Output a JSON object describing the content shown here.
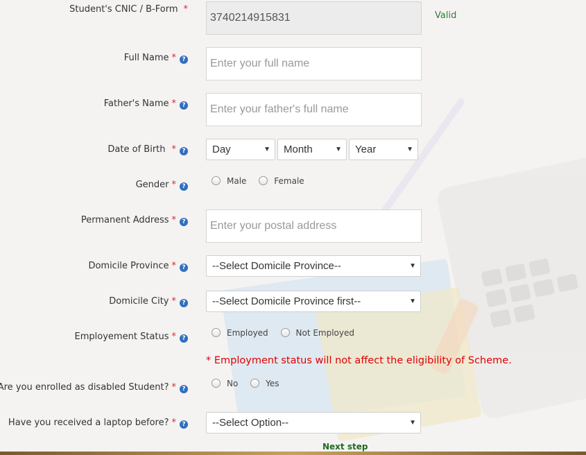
{
  "form": {
    "cnic": {
      "label": "Student's CNIC / B-Form",
      "required": "*",
      "value": "3740214915831",
      "status": "Valid"
    },
    "full_name": {
      "label": "Full Name",
      "required": "*",
      "help": "?",
      "placeholder": "Enter your full name"
    },
    "father_name": {
      "label": "Father's Name",
      "required": "*",
      "help": "?",
      "placeholder": "Enter your father's full name"
    },
    "dob": {
      "label": "Date of Birth",
      "required": "*",
      "help": "?",
      "day": "Day",
      "month": "Month",
      "year": "Year"
    },
    "gender": {
      "label": "Gender",
      "required": "*",
      "help": "?",
      "options": [
        "Male",
        "Female"
      ]
    },
    "address": {
      "label": "Permanent Address",
      "required": "*",
      "help": "?",
      "placeholder": "Enter your postal address"
    },
    "domicile_province": {
      "label": "Domicile Province",
      "required": "*",
      "help": "?",
      "selected": "--Select Domicile Province--"
    },
    "domicile_city": {
      "label": "Domicile City",
      "required": "*",
      "help": "?",
      "selected": "--Select Domicile Province first--"
    },
    "employment": {
      "label": "Employement Status",
      "required": "*",
      "help": "?",
      "options": [
        "Employed",
        "Not Employed"
      ],
      "note": "* Employment status will not affect the eligibility of Scheme."
    },
    "disabled": {
      "label": "Are you enrolled as disabled Student?",
      "required": "*",
      "help": "?",
      "options": [
        "No",
        "Yes"
      ]
    },
    "laptop": {
      "label": "Have you received a laptop before?",
      "required": "*",
      "help": "?",
      "selected": "--Select Option--"
    },
    "next_step": "Next step"
  },
  "icons": {
    "help": "question-circle-icon",
    "dropdown": "triangle-down-icon"
  },
  "colors": {
    "required": "#e0262a",
    "help": "#2f6fbf",
    "valid": "#2e7d2e",
    "note": "#e00000"
  }
}
